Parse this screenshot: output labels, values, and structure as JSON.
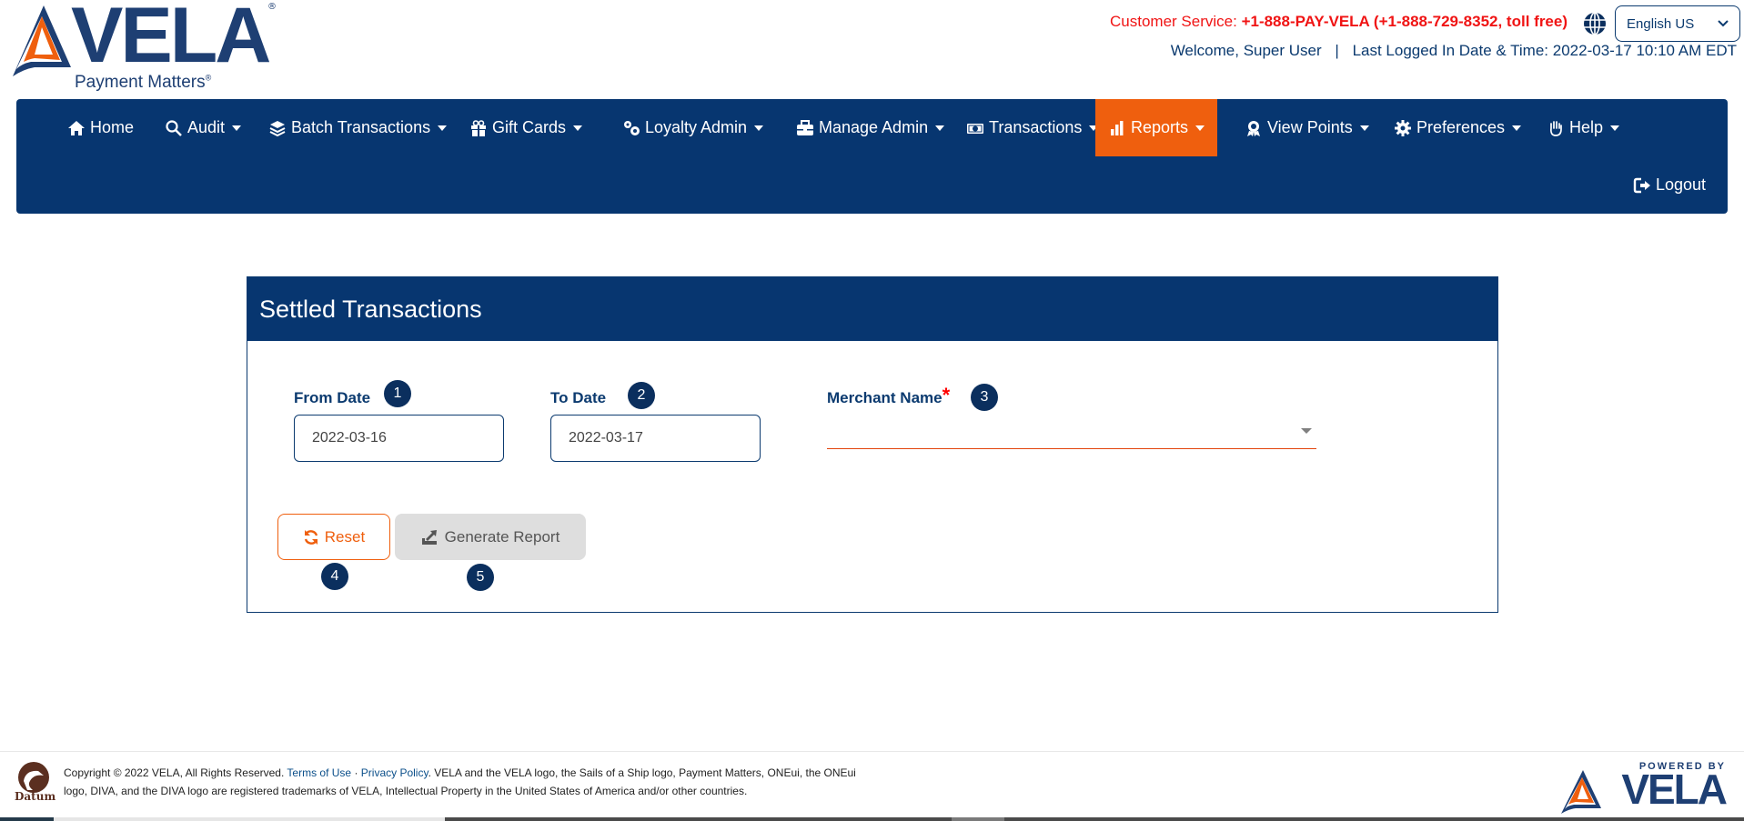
{
  "brand": {
    "name": "VELA",
    "tagline": "Payment Matters",
    "registered_mark": "®"
  },
  "topbar": {
    "customer_service_label": "Customer Service:",
    "customer_service_number": "+1-888-PAY-VELA (+1-888-729-8352, toll free)",
    "language": {
      "selected": "English US",
      "icon": "globe-icon"
    },
    "welcome_label": "Welcome,",
    "user_name": "Super User",
    "separator": "|",
    "last_login_label": "Last Logged In Date & Time:",
    "last_login_value": "2022-03-17 10:10 AM EDT"
  },
  "nav": {
    "items": [
      {
        "label": "Home",
        "icon": "home-icon",
        "dropdown": false,
        "active": false
      },
      {
        "label": "Audit",
        "icon": "search-audit-icon",
        "dropdown": true,
        "active": false
      },
      {
        "label": "Batch Transactions",
        "icon": "layers-icon",
        "dropdown": true,
        "active": false
      },
      {
        "label": "Gift Cards",
        "icon": "gift-icon",
        "dropdown": true,
        "active": false
      },
      {
        "label": "Loyalty Admin",
        "icon": "cogs-icon",
        "dropdown": true,
        "active": false
      },
      {
        "label": "Manage Admin",
        "icon": "toolbox-icon",
        "dropdown": true,
        "active": false
      },
      {
        "label": "Transactions",
        "icon": "money-bill-icon",
        "dropdown": true,
        "active": false
      },
      {
        "label": "Reports",
        "icon": "bar-chart-icon",
        "dropdown": true,
        "active": true
      },
      {
        "label": "View Points",
        "icon": "award-icon",
        "dropdown": true,
        "active": false
      },
      {
        "label": "Preferences",
        "icon": "gear-icon",
        "dropdown": true,
        "active": false
      },
      {
        "label": "Help",
        "icon": "hand-icon",
        "dropdown": true,
        "active": false
      }
    ],
    "logout": {
      "label": "Logout",
      "icon": "sign-out-icon"
    }
  },
  "colors": {
    "primary": "#073670",
    "accent": "#ef5f0e",
    "required": "#ff0000",
    "disabled_button": "#dedede"
  },
  "report": {
    "title": "Settled Transactions",
    "from_date": {
      "label": "From Date",
      "value": "2022-03-16",
      "badge": "1"
    },
    "to_date": {
      "label": "To Date",
      "value": "2022-03-17",
      "badge": "2"
    },
    "merchant": {
      "label": "Merchant Name",
      "required_mark": "*",
      "value": "",
      "badge": "3"
    },
    "reset_button": {
      "label": "Reset",
      "icon": "refresh-icon",
      "badge": "4"
    },
    "generate_button": {
      "label": "Generate Report",
      "icon": "export-icon",
      "badge": "5",
      "disabled": true
    }
  },
  "footer": {
    "datum_label": "Datum",
    "copyright": "Copyright © 2022 VELA, All Rights Reserved.",
    "terms_link": "Terms of Use",
    "dot": " · ",
    "privacy_link": "Privacy Policy",
    "trademark_text": ". VELA and the VELA logo, the Sails of a Ship logo, Payment Matters, ONEui, the ONEui logo, DIVA, and the DIVA logo are registered trademarks of VELA, Intellectual Property in the United States of America and/or other countries.",
    "powered_by": "POWERED BY",
    "powered_brand": "VELA"
  }
}
